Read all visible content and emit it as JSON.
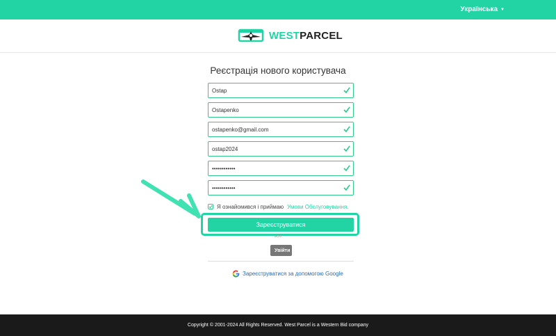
{
  "topbar": {
    "language": "Українська"
  },
  "logo": {
    "brand_west": "WEST",
    "brand_parcel": "PARCEL",
    "icon": "plane-box-logo-icon"
  },
  "form": {
    "title": "Реєстрація нового користувача",
    "fields": [
      {
        "value": "Ostap",
        "status": "valid"
      },
      {
        "value": "Ostapenko",
        "status": "valid"
      },
      {
        "value": "ostapenko@gmail.com",
        "status": "valid"
      },
      {
        "value": "ostap2024",
        "status": "valid"
      },
      {
        "value": "••••••••••••",
        "status": "valid"
      },
      {
        "value": "••••••••••••",
        "status": "valid"
      }
    ],
    "agree_text": "Я ознайомився і приймаю",
    "agree_link": "Умови Обслуговування.",
    "agree_checked": true,
    "register_button": "Зареєструватися",
    "or_text": "або",
    "login_button": "Увійти",
    "google_text": "Зареєструватися за допомогою Google"
  },
  "footer": {
    "copyright": "Copyright © 2001-2024 All Rights Reserved. West Parcel is a Western Bid company"
  },
  "colors": {
    "accent": "#22d3a4",
    "valid_border": "#2fc98a",
    "footer_bg": "#1a1a1a",
    "login_bg": "#777777"
  }
}
